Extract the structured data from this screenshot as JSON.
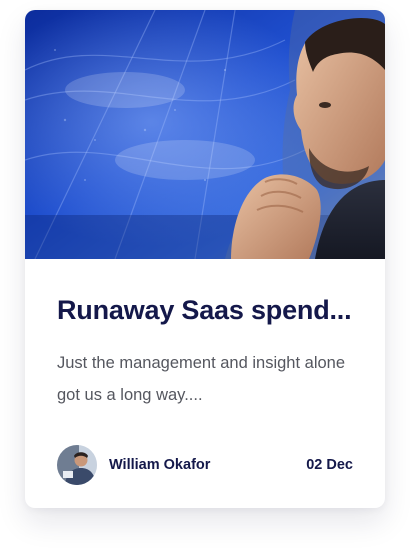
{
  "post": {
    "title": "Runaway Saas spend...",
    "excerpt": "Just the management and insight alone got us a long way....",
    "author_name": "William Okafor",
    "date": "02 Dec",
    "image_icon": "man-thinking-photo",
    "avatar_icon": "author-avatar-photo"
  },
  "colors": {
    "title": "#14184a",
    "text": "#55575f",
    "hero_blue": "#1b3fb8"
  }
}
